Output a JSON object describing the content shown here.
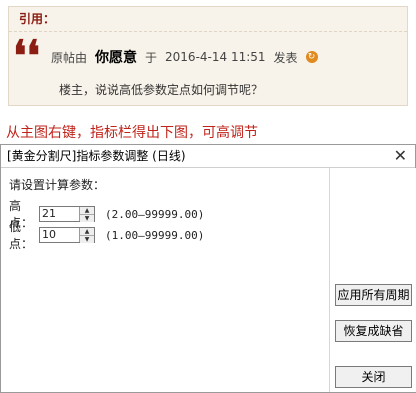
{
  "quote": {
    "header": "引用：",
    "original_by": "原帖由",
    "author": "你愿意",
    "at": "于",
    "datetime": "2016-4-14 11:51",
    "posted": "发表",
    "goto_glyph": "↻",
    "body": "楼主，说说高低参数定点如何调节呢？"
  },
  "caption": "从主图右键，指标栏得出下图，可高调节",
  "dialog": {
    "title": "[黄金分割尺]指标参数调整 (日线)",
    "close_glyph": "✕",
    "prompt": "请设置计算参数：",
    "params": [
      {
        "label": "高点：",
        "value": "21",
        "range": "(2.00—99999.00)"
      },
      {
        "label": "低点：",
        "value": "10",
        "range": "(1.00—99999.00)"
      }
    ],
    "buttons": {
      "apply_all": "应用所有周期",
      "restore_default": "恢复成缺省",
      "close": "关闭"
    }
  }
}
